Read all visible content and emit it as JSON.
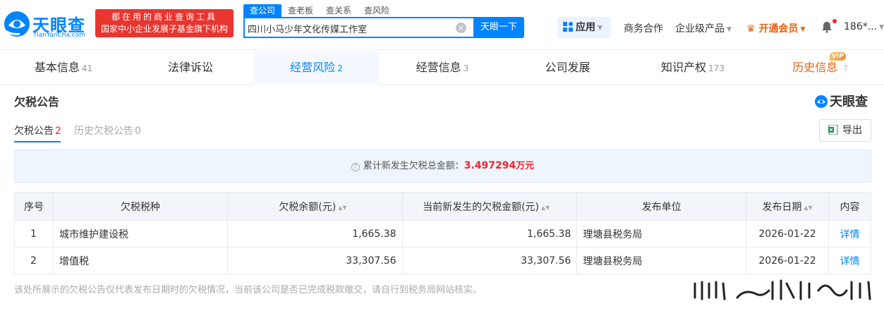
{
  "header": {
    "logo_text": "天眼查",
    "logo_sub": "TianYanCha.com",
    "slogan_line1": "都在用的商业查询工具",
    "slogan_line2": "国家中小企业发展子基金旗下机构",
    "search_tabs": [
      "查公司",
      "查老板",
      "查关系",
      "查风险"
    ],
    "search_value": "四川小马少年文化传媒工作室",
    "search_button": "天眼一下",
    "app_button": "应用",
    "nav": {
      "business": "商务合作",
      "enterprise": "企业级产品",
      "vip": "开通会员",
      "user": "186*..."
    }
  },
  "section_tabs": [
    {
      "label": "基本信息",
      "count": "41"
    },
    {
      "label": "法律诉讼",
      "count": ""
    },
    {
      "label": "经营风险",
      "count": "2"
    },
    {
      "label": "经营信息",
      "count": "3"
    },
    {
      "label": "公司发展",
      "count": ""
    },
    {
      "label": "知识产权",
      "count": "173"
    },
    {
      "label": "历史信息",
      "count": ""
    }
  ],
  "vip_badge": "VIP",
  "panel": {
    "title": "欠税公告",
    "brand": "天眼查",
    "sub_tabs": [
      {
        "label": "欠税公告",
        "count": "2"
      },
      {
        "label": "历史欠税公告",
        "count": "0"
      }
    ],
    "export_label": "导出",
    "summary_label": "累计新发生欠税总金额：",
    "summary_amount": "3.497294",
    "summary_unit": "万元",
    "columns": [
      "序号",
      "欠税税种",
      "欠税余额(元)",
      "当前新发生的欠税金额(元)",
      "发布单位",
      "发布日期",
      "内容"
    ],
    "rows": [
      {
        "index": "1",
        "tax_type": "城市维护建设税",
        "balance": "1,665.38",
        "new_amount": "1,665.38",
        "unit": "理塘县税务局",
        "date": "2026-01-22",
        "action": "详情"
      },
      {
        "index": "2",
        "tax_type": "增值税",
        "balance": "33,307.56",
        "new_amount": "33,307.56",
        "unit": "理塘县税务局",
        "date": "2026-01-22",
        "action": "详情"
      }
    ],
    "footnote": "该处所展示的欠税公告仅代表发布日期时的欠税情况，当前该公司是否已完成税款缴交，请自行到税务局网站核实。"
  },
  "colors": {
    "brand_blue": "#0084ff",
    "alert_red": "#f5222d",
    "vip_orange": "#e6620f"
  }
}
